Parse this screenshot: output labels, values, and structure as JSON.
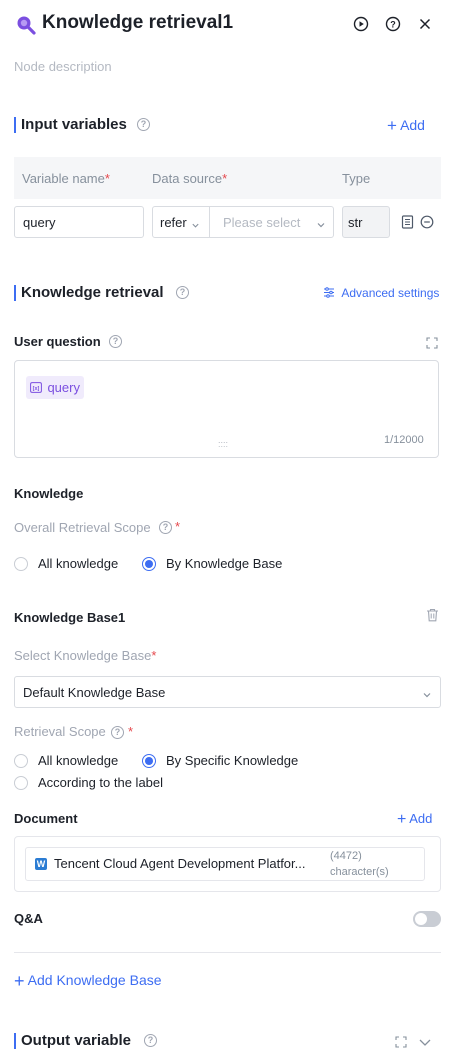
{
  "header": {
    "title": "Knowledge retrieval1",
    "description_placeholder": "Node description"
  },
  "input_variables": {
    "title": "Input variables",
    "add_label": "Add",
    "columns": [
      "Variable name",
      "Data source",
      "Type"
    ],
    "rows": [
      {
        "name": "query",
        "source_mode": "refer",
        "source_placeholder": "Please select",
        "type": "str"
      }
    ]
  },
  "knowledge_retrieval": {
    "title": "Knowledge retrieval",
    "advanced_label": "Advanced settings",
    "user_question": {
      "label": "User question",
      "variable_tag": "query",
      "counter": "1/12000"
    },
    "knowledge": {
      "title": "Knowledge",
      "scope_label": "Overall Retrieval Scope",
      "options": [
        "All knowledge",
        "By Knowledge Base"
      ],
      "selected": "By Knowledge Base"
    },
    "knowledge_base": {
      "title": "Knowledge Base1",
      "select_label": "Select Knowledge Base",
      "selected_value": "Default Knowledge Base",
      "scope_label": "Retrieval Scope",
      "scope_options": [
        "All knowledge",
        "By Specific Knowledge",
        "According to the label"
      ],
      "scope_selected": "By Specific Knowledge",
      "document_label": "Document",
      "document_add_label": "Add",
      "document_name": "Tencent Cloud Agent Development Platfor...",
      "document_count": "(4472)",
      "document_unit": "character(s)",
      "qa_label": "Q&A",
      "qa_enabled": false
    },
    "add_kb_label": "Add Knowledge Base"
  },
  "output_variable": {
    "title": "Output variable"
  },
  "colors": {
    "accent": "#3d6df2",
    "header_icon": "#7b4fe0",
    "required": "#e5484d"
  }
}
